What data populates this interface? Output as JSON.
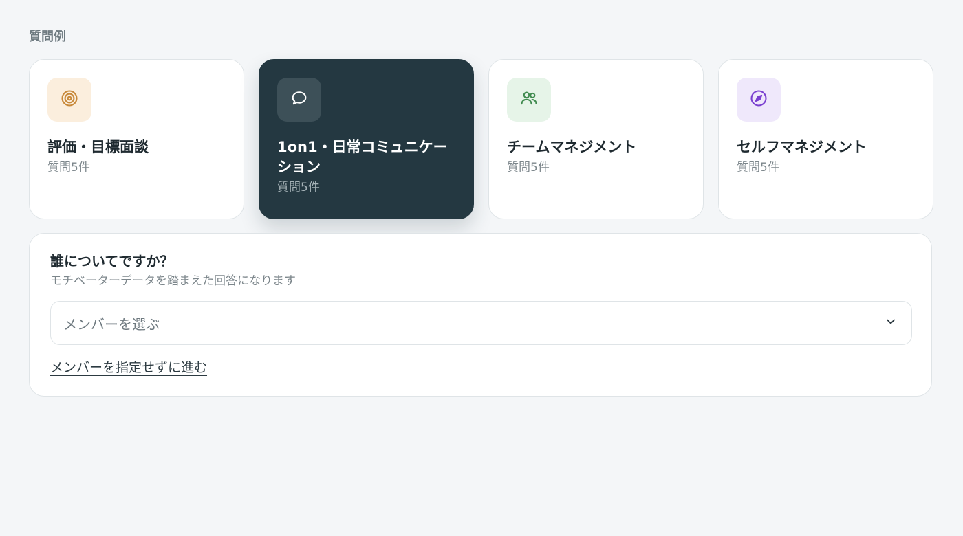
{
  "section_label": "質問例",
  "cards": [
    {
      "title": "評価・目標面談",
      "count": "質問5件",
      "icon": "target-icon",
      "icon_bg": "#fbeedd",
      "icon_color": "#c8893a",
      "active": false
    },
    {
      "title": "1on1・日常コミュニケーション",
      "count": "質問5件",
      "icon": "chat-bubble-icon",
      "icon_bg": "#3d5058",
      "icon_color": "#ffffff",
      "active": true
    },
    {
      "title": "チームマネジメント",
      "count": "質問5件",
      "icon": "users-icon",
      "icon_bg": "#e6f4e8",
      "icon_color": "#3f8a4e",
      "active": false
    },
    {
      "title": "セルフマネジメント",
      "count": "質問5件",
      "icon": "compass-icon",
      "icon_bg": "#efe8fb",
      "icon_color": "#7a3fd0",
      "active": false
    }
  ],
  "member_panel": {
    "title": "誰についてですか？",
    "subtitle": "モチベーターデータを踏まえた回答になります",
    "select_placeholder": "メンバーを選ぶ",
    "skip_link": "メンバーを指定せずに進む"
  },
  "colors": {
    "background": "#f4f6f8",
    "active_card": "#243841",
    "card_border": "#dfe4e7"
  }
}
